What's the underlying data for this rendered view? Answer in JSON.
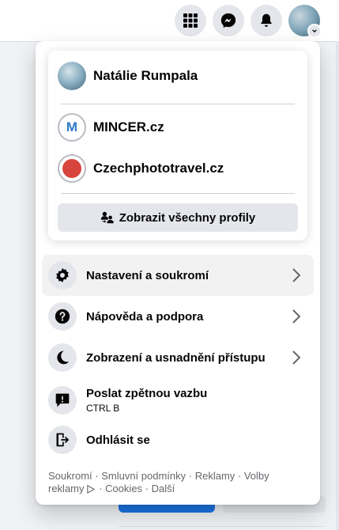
{
  "account_menu": {
    "profiles": [
      {
        "name": "Natálie Rumpala"
      },
      {
        "name": "MINCER.cz",
        "initial": "M"
      },
      {
        "name": "Czechphototravel.cz"
      }
    ],
    "see_all_label": "Zobrazit všechny profily",
    "items": [
      {
        "label": "Nastavení a soukromí",
        "icon": "gear-icon"
      },
      {
        "label": "Nápověda a podpora",
        "icon": "question-icon"
      },
      {
        "label": "Zobrazení a usnadnění přístupu",
        "icon": "moon-icon"
      },
      {
        "label": "Poslat zpětnou vazbu",
        "sub": "CTRL B",
        "icon": "feedback-icon"
      },
      {
        "label": "Odhlásit se",
        "icon": "logout-icon"
      }
    ],
    "footer": {
      "privacy": "Soukromí",
      "terms": "Smluvní podmínky",
      "ads": "Reklamy",
      "ad_choices": "Volby reklamy",
      "cookies": "Cookies",
      "more": "Další",
      "separator": " · "
    }
  },
  "colors": {
    "accent": "#1b74e4",
    "surface": "#ffffff",
    "secondary_button": "#e4e6eb",
    "secondary_text": "#65676b"
  }
}
